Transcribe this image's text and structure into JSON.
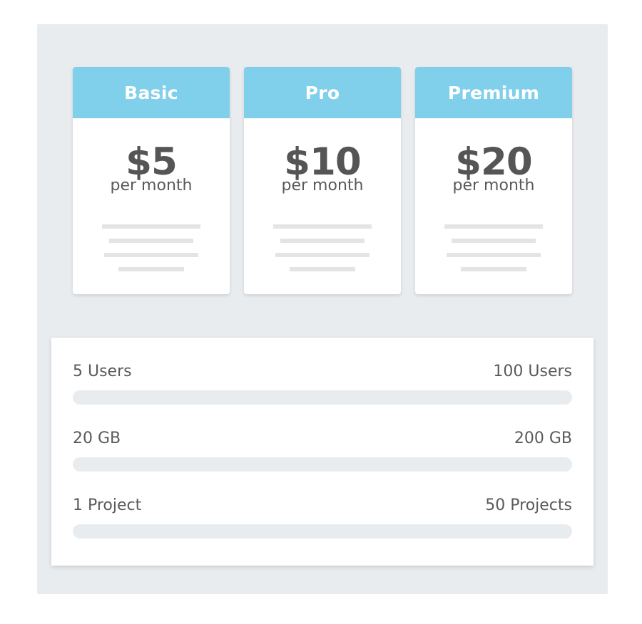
{
  "plans": [
    {
      "name": "Basic",
      "price": "$5",
      "period": "per month"
    },
    {
      "name": "Pro",
      "price": "$10",
      "period": "per month"
    },
    {
      "name": "Premium",
      "price": "$20",
      "period": "per month"
    }
  ],
  "limits": [
    {
      "min_label": "5 Users",
      "max_label": "100 Users"
    },
    {
      "min_label": "20 GB",
      "max_label": "200 GB"
    },
    {
      "min_label": "1 Project",
      "max_label": "50 Projects"
    }
  ],
  "colors": {
    "header_accent": "#80cfeb",
    "panel_background": "#e9ecef",
    "track": "#e9ecef",
    "text": "#555555"
  }
}
